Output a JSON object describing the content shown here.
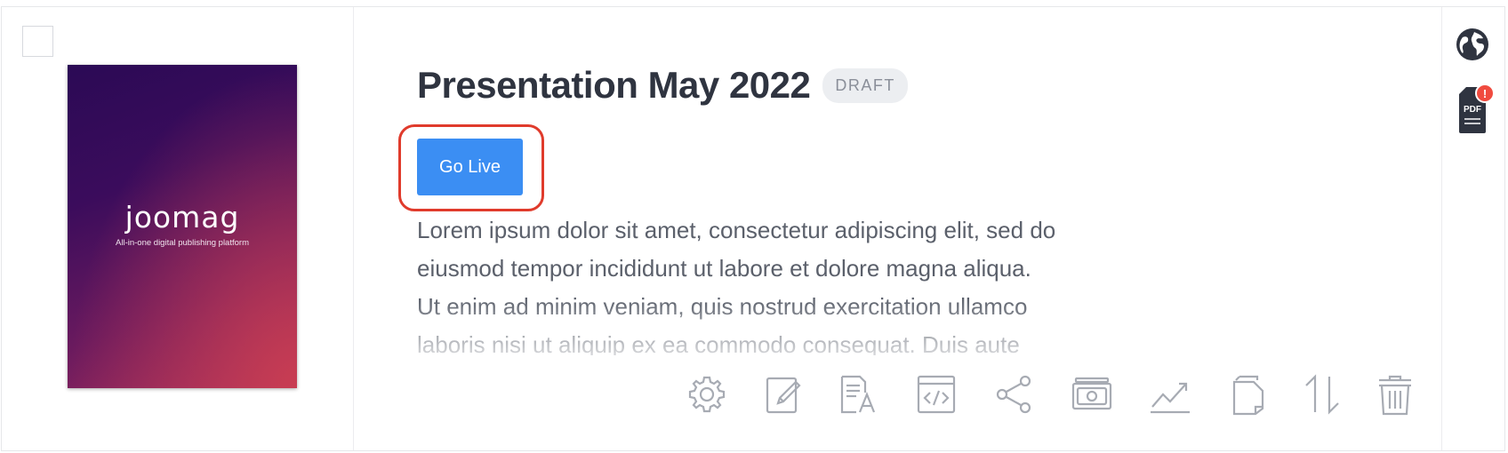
{
  "item": {
    "title": "Presentation May 2022",
    "status_badge": "DRAFT",
    "go_live_label": "Go Live",
    "description_lines": [
      "Lorem ipsum dolor sit amet, consectetur adipiscing elit, sed do",
      "eiusmod tempor incididunt ut labore et dolore magna aliqua.",
      "Ut enim ad minim veniam, quis nostrud exercitation ullamco",
      "laboris nisi ut aliquip ex ea commodo consequat. Duis aute"
    ]
  },
  "cover": {
    "logo_text": "joomag",
    "tagline": "All-in-one digital publishing platform"
  },
  "side_icons": {
    "globe": "globe-icon",
    "pdf": "pdf-file-icon",
    "pdf_label": "PDF",
    "pdf_alert": "!"
  },
  "toolbar": [
    "settings-icon",
    "edit-icon",
    "translate-icon",
    "embed-code-icon",
    "share-icon",
    "monetize-icon",
    "analytics-icon",
    "duplicate-icon",
    "sort-icon",
    "delete-icon"
  ],
  "colors": {
    "accent": "#3b8ef3",
    "highlight": "#e03b2c",
    "title": "#2f3440",
    "badge_bg": "#eceef1",
    "icon_gray": "#a7abb3",
    "alert": "#f04b3f"
  }
}
